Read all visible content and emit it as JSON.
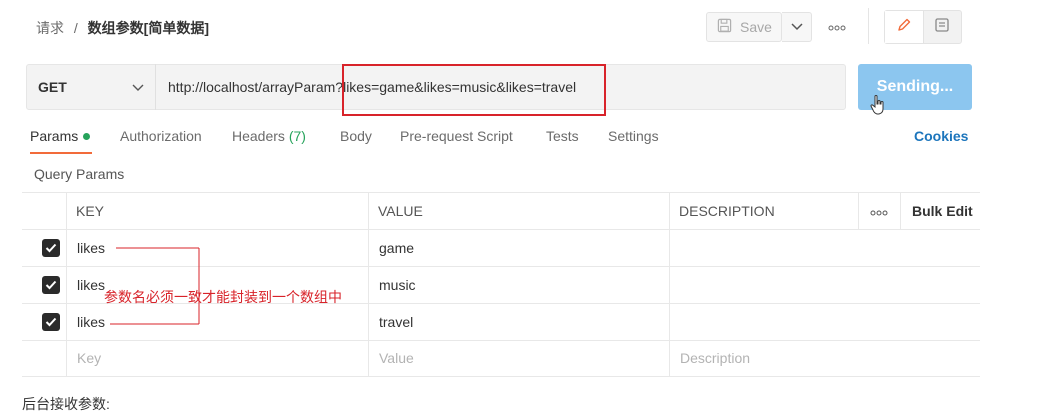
{
  "breadcrumb": {
    "parent": "请求",
    "separator": "/",
    "current": "数组参数[简单数据]"
  },
  "toolbar": {
    "save_label": "Save"
  },
  "request": {
    "method": "GET",
    "url": "http://localhost/arrayParam?likes=game&likes=music&likes=travel",
    "send_label": "Sending..."
  },
  "tabs": [
    {
      "label": "Params"
    },
    {
      "label": "Authorization"
    },
    {
      "label": "Headers",
      "count": "(7)"
    },
    {
      "label": "Body"
    },
    {
      "label": "Pre-request Script"
    },
    {
      "label": "Tests"
    },
    {
      "label": "Settings"
    }
  ],
  "cookies_label": "Cookies",
  "section_title": "Query Params",
  "table": {
    "headers": {
      "key": "KEY",
      "value": "VALUE",
      "description": "DESCRIPTION",
      "bulk_edit": "Bulk Edit"
    },
    "rows": [
      {
        "key": "likes",
        "value": "game",
        "description": "",
        "checked": true
      },
      {
        "key": "likes",
        "value": "music",
        "description": "",
        "checked": true
      },
      {
        "key": "likes",
        "value": "travel",
        "description": "",
        "checked": true
      }
    ],
    "placeholders": {
      "key": "Key",
      "value": "Value",
      "description": "Description"
    }
  },
  "annotation": "参数名必须一致才能封装到一个数组中",
  "footer_text": "后台接收参数:",
  "colors": {
    "accent_orange": "#f26b3a",
    "send_blue": "#8cc6ef",
    "link_blue": "#1c75bc",
    "status_green": "#26a35b",
    "annotation_red": "#d8232a"
  }
}
